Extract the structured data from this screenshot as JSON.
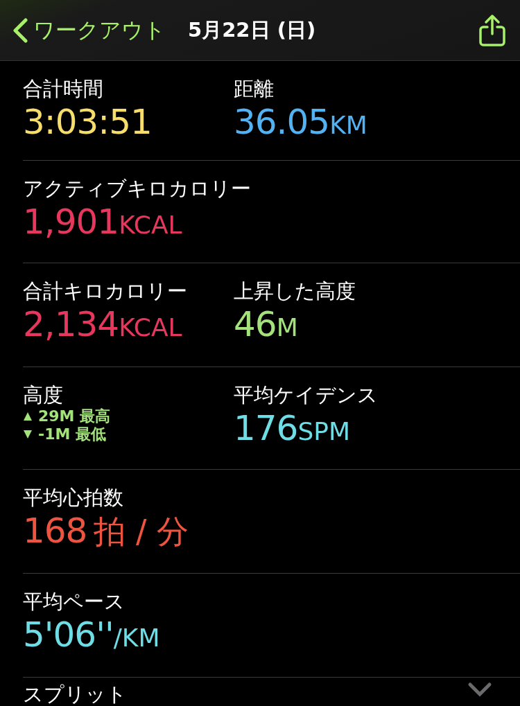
{
  "nav": {
    "back_label": "ワークアウト",
    "title": "5月22日 (日)"
  },
  "rows": [
    {
      "cells": [
        {
          "kind": "metric",
          "label": "合計時間",
          "value": "3:03:51",
          "color": "#f6dd6c"
        },
        {
          "kind": "metric",
          "label": "距離",
          "value": "36.05",
          "unit": "KM",
          "color": "#52b2f2"
        }
      ]
    },
    {
      "cells": [
        {
          "kind": "metric",
          "label": "アクティブキロカロリー",
          "value": "1,901",
          "unit": "KCAL",
          "color": "#e7375c"
        }
      ]
    },
    {
      "cells": [
        {
          "kind": "metric",
          "label": "合計キロカロリー",
          "value": "2,134",
          "unit": "KCAL",
          "color": "#e7375c"
        },
        {
          "kind": "metric",
          "label": "上昇した高度",
          "value": "46",
          "unit": "M",
          "color": "#a4e27c"
        }
      ]
    },
    {
      "cells": [
        {
          "kind": "range",
          "label": "高度",
          "color": "#a4e27c",
          "lines": [
            {
              "kind": "max",
              "text": "29M 最高"
            },
            {
              "kind": "min",
              "text": "-1M 最低"
            }
          ]
        },
        {
          "kind": "metric",
          "label": "平均ケイデンス",
          "value": "176",
          "unit": "SPM",
          "color": "#6fdde6"
        }
      ]
    },
    {
      "cells": [
        {
          "kind": "metric_wide_unit",
          "label": "平均心拍数",
          "value": "168",
          "unit": "拍 / 分",
          "color": "#ee5540"
        }
      ]
    },
    {
      "cells": [
        {
          "kind": "metric",
          "label": "平均ペース",
          "value": "5'06''",
          "unit": "/KM",
          "color": "#6fdde6"
        }
      ]
    }
  ],
  "section": {
    "label": "スプリット",
    "expanded": false
  }
}
